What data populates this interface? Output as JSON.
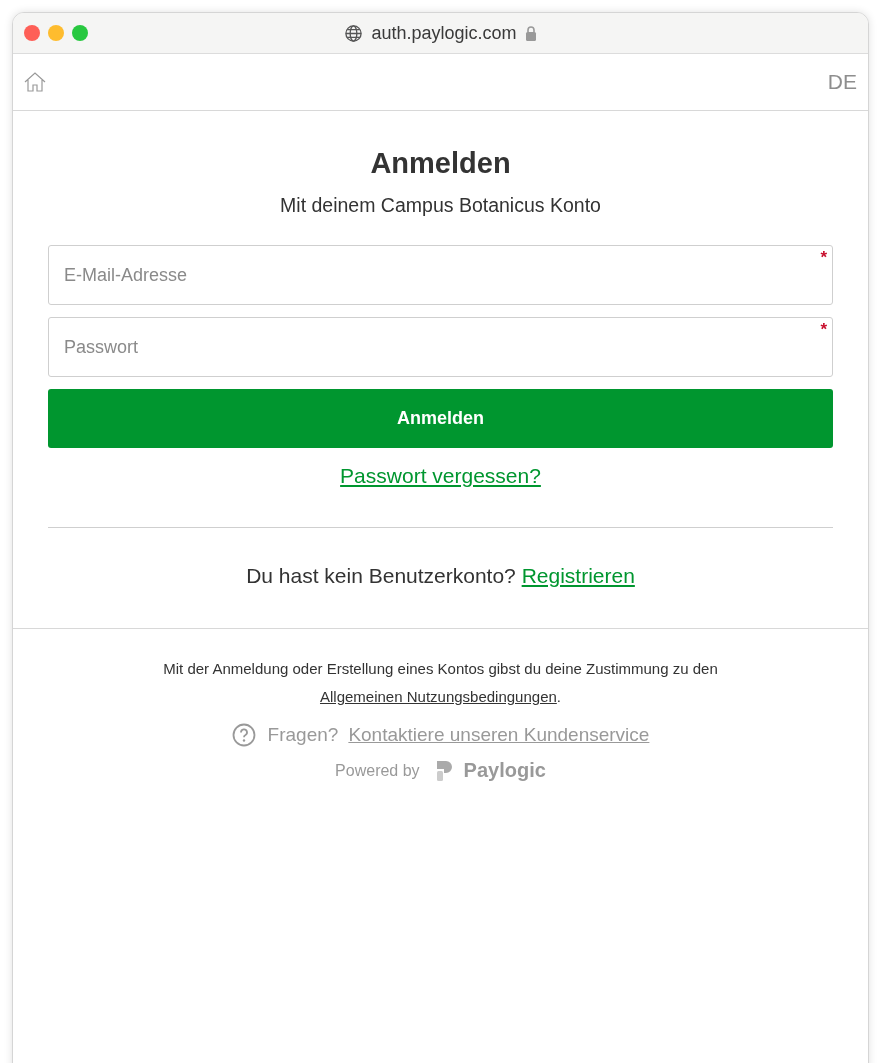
{
  "window": {
    "url": "auth.paylogic.com",
    "secure": true
  },
  "nav": {
    "language": "DE"
  },
  "login": {
    "title": "Anmelden",
    "subtitle": "Mit deinem Campus Botanicus Konto",
    "fields": [
      {
        "placeholder": "E-Mail-Adresse",
        "required": true,
        "required_mark": "*"
      },
      {
        "placeholder": "Passwort",
        "required": true,
        "required_mark": "*"
      }
    ],
    "submit": "Anmelden",
    "forgot": "Passwort vergessen?",
    "register": {
      "text": "Du hast kein Benutzerkonto?",
      "link": "Registrieren"
    }
  },
  "footer": {
    "terms": {
      "before": "Mit der Anmeldung oder Erstellung eines Kontos gibst du deine Zustimmung zu den",
      "link": "Allgemeinen Nutzungsbedingungen",
      "after": "."
    },
    "help": {
      "text": "Fragen?",
      "link": "Kontaktiere unseren Kundenservice"
    },
    "powered": "Powered by",
    "brand": "Paylogic"
  }
}
